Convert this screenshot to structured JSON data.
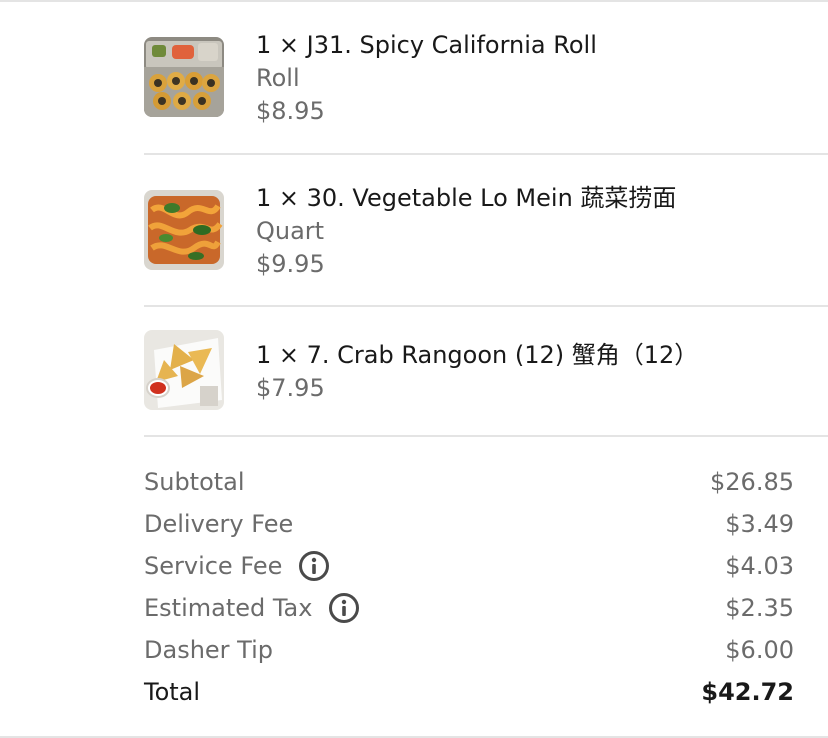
{
  "items": [
    {
      "name": "1 × J31. Spicy California Roll",
      "detail": "Roll",
      "price": "$8.95",
      "image_icon": "sushi-roll-photo"
    },
    {
      "name": "1 × 30. Vegetable Lo Mein 蔬菜捞面",
      "detail": "Quart",
      "price": "$9.95",
      "image_icon": "lo-mein-photo"
    },
    {
      "name": "1 × 7. Crab Rangoon (12) 蟹角（12）",
      "price": "$7.95",
      "image_icon": "crab-rangoon-photo"
    }
  ],
  "summary": {
    "subtotal_label": "Subtotal",
    "subtotal": "$26.85",
    "delivery_label": "Delivery Fee",
    "delivery": "$3.49",
    "service_label": "Service Fee",
    "service": "$4.03",
    "tax_label": "Estimated Tax",
    "tax": "$2.35",
    "tip_label": "Dasher Tip",
    "tip": "$6.00",
    "total_label": "Total",
    "total": "$42.72"
  },
  "colors": {
    "primary_text": "#191919",
    "secondary_text": "#6b6b6b",
    "divider": "#e4e4e4"
  }
}
